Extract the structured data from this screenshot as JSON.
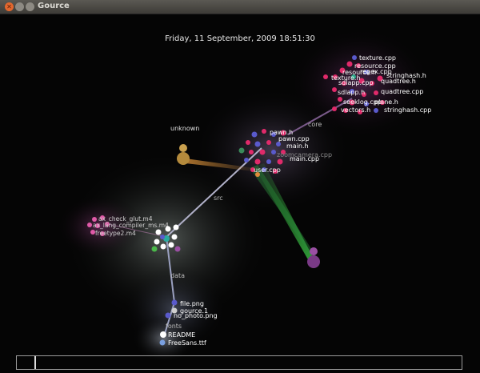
{
  "window": {
    "title": "Gource"
  },
  "datetime": "Friday, 11 September, 2009 18:51:30",
  "dir_labels": {
    "core": "core",
    "src": "src",
    "data": "data",
    "fonts": "fonts"
  },
  "users": {
    "unknown": "unknown"
  },
  "files": {
    "core": [
      "texture.cpp",
      "resource.cpp",
      "regex.cpp",
      "resource.h",
      "quadtree.h",
      "stringhash.h",
      "texture.h",
      "quadtree.cpp",
      "sdlapp.cpp",
      "sdlapp.h",
      "seeklog.cpp",
      "plane.h",
      "vectors.h",
      "stringhash.cpp"
    ],
    "src": [
      "pawn.h",
      "pawn.cpp",
      "main.h",
      "main.cpp",
      "zoomcamera.cpp",
      "user.cpp"
    ],
    "m4": [
      "ax_check_glut.m4",
      "ax_lang_compiler_ms.m4",
      "freetype2.m4"
    ],
    "data": [
      "file.png",
      "gource.1",
      "no_photo.png"
    ],
    "fonts": [
      "README",
      "FreeSans.ttf"
    ]
  },
  "colors": {
    "titlebar": "#4a4843",
    "close": "#e2672e",
    "edge": "#8e8ea8",
    "beam_green": "#3fd04a",
    "beam_orange": "#f0a040",
    "user_orange": "#c9a04e",
    "user_purple": "#9a4fa3"
  },
  "timeline": {
    "position": 0.04
  }
}
